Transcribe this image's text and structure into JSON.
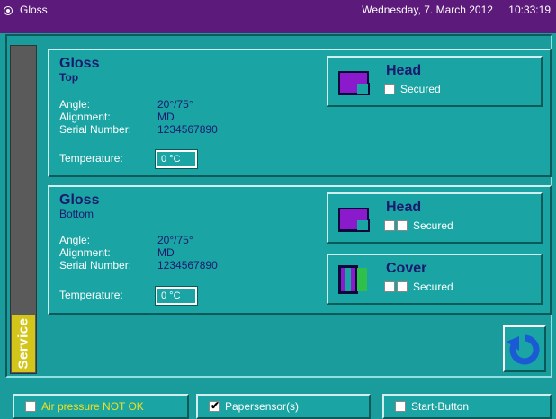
{
  "titlebar": {
    "title": "Gloss",
    "date": "Wednesday, 7. March 2012",
    "time": "10:33:19"
  },
  "service_tab": {
    "label": "Service"
  },
  "panels": {
    "top": {
      "title": "Gloss",
      "subtitle": "Top",
      "angle_label": "Angle:",
      "angle_value": "20°/75°",
      "alignment_label": "Alignment:",
      "alignment_value": "MD",
      "serial_label": "Serial Number:",
      "serial_value": "1234567890",
      "temperature_label": "Temperature:",
      "temperature_value": "0 °C",
      "head": {
        "title": "Head",
        "secured_label": "Secured"
      }
    },
    "bottom": {
      "title": "Gloss",
      "subtitle": "Bottom",
      "angle_label": "Angle:",
      "angle_value": "20°/75°",
      "alignment_label": "Alignment:",
      "alignment_value": "MD",
      "serial_label": "Serial Number:",
      "serial_value": "1234567890",
      "temperature_label": "Temperature:",
      "temperature_value": "0 °C",
      "head": {
        "title": "Head",
        "secured_label": "Secured"
      },
      "cover": {
        "title": "Cover",
        "secured_label": "Secured"
      }
    }
  },
  "status_bar": {
    "air_pressure": {
      "label": "Air pressure NOT OK",
      "checked": false
    },
    "papersensor": {
      "label": "Papersensor(s)",
      "checked": true
    },
    "start_button": {
      "label": "Start-Button",
      "checked": false
    }
  },
  "colors": {
    "titlebar_bg": "#5c1a7a",
    "panel_bg": "#1aa4a4",
    "title_text": "#1a1a6e",
    "service_tab": "#d4c51a",
    "warning_text": "#f0e020",
    "head_icon": "#8a1acc",
    "cover_icon_green": "#2ec04a",
    "refresh_icon": "#1a5ad4"
  },
  "icons": {
    "titlebar": "radio-icon",
    "head": "head-icon",
    "cover": "cover-icon",
    "refresh": "refresh-icon"
  }
}
